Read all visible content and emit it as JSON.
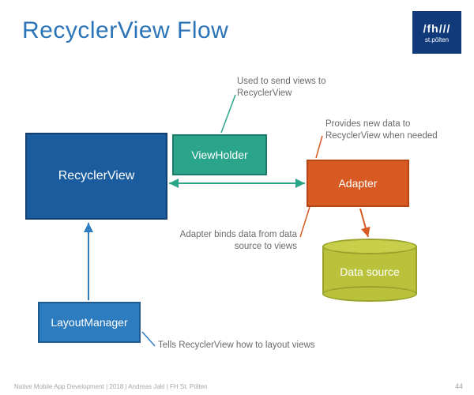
{
  "title": "RecyclerView Flow",
  "logo": {
    "brand": "/fh///",
    "sub": "st.pölten"
  },
  "boxes": {
    "recycler": "RecyclerView",
    "viewholder": "ViewHolder",
    "adapter": "Adapter",
    "layoutmanager": "LayoutManager",
    "datasource": "Data source"
  },
  "notes": {
    "viewholder_note": "Used to send views to RecyclerView",
    "adapter_note": "Provides new data to RecyclerView when needed",
    "bind_note": "Adapter binds data from data source to views",
    "layout_note": "Tells RecyclerView how to layout views"
  },
  "footer": "Native Mobile App Development | 2018 | Andreas Jakl | FH St. Pölten",
  "page": "44",
  "colors": {
    "title": "#2b74b8",
    "recycler": "#1b5c9e",
    "viewholder": "#2aa58a",
    "adapter": "#d85a23",
    "layoutmanager": "#2d7cc0",
    "datasource": "#b9c23a",
    "logo_bg": "#103a7a",
    "arrow_green": "#2aa58a",
    "arrow_blue": "#2d7cc0",
    "arrow_orange": "#d85a23"
  },
  "diagram": {
    "nodes": [
      {
        "id": "RecyclerView",
        "type": "rect"
      },
      {
        "id": "ViewHolder",
        "type": "rect"
      },
      {
        "id": "Adapter",
        "type": "rect"
      },
      {
        "id": "LayoutManager",
        "type": "rect"
      },
      {
        "id": "DataSource",
        "type": "cylinder"
      }
    ],
    "edges": [
      {
        "from": "RecyclerView",
        "to": "Adapter",
        "style": "bidirectional",
        "color": "green"
      },
      {
        "from": "ViewHolder",
        "to": "RecyclerView",
        "style": "overlap",
        "note": "Used to send views to RecyclerView"
      },
      {
        "from": "LayoutManager",
        "to": "RecyclerView",
        "style": "arrow",
        "color": "blue",
        "note": "Tells RecyclerView how to layout views"
      },
      {
        "from": "Adapter",
        "to": "DataSource",
        "style": "arrow",
        "color": "orange"
      },
      {
        "from": "Adapter",
        "to": "RecyclerView",
        "note": "Provides new data to RecyclerView when needed"
      },
      {
        "from": "Adapter",
        "to": "views",
        "note": "Adapter binds data from data source to views"
      }
    ]
  }
}
